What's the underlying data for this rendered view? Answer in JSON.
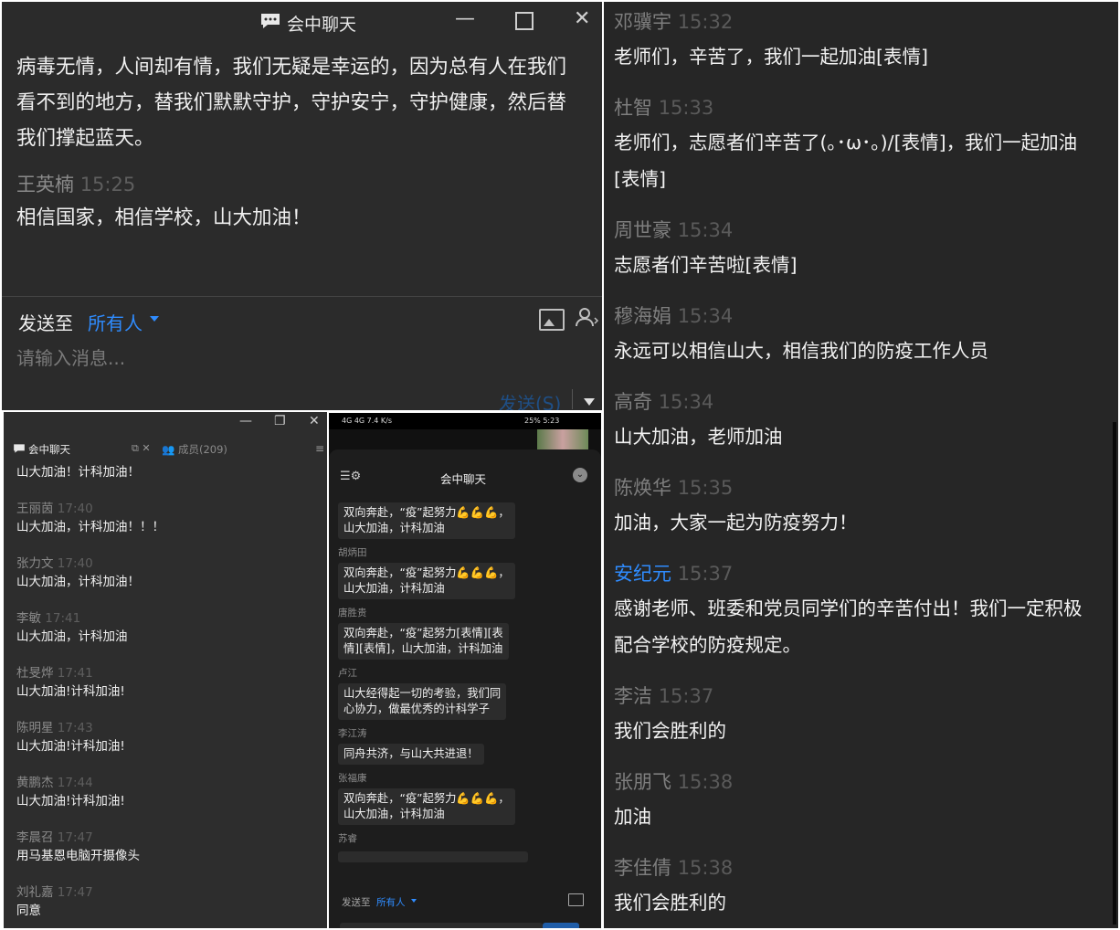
{
  "top_window": {
    "title": "会中聊天",
    "messages": [
      {
        "sender": "",
        "time": "",
        "lines": [
          "病毒无情，人间却有情，我们无疑是幸运的，因为总有人在我们",
          "看不到的地方，替我们默默守护，守护安宁，守护健康，然后替",
          "我们撑起蓝天。"
        ]
      },
      {
        "sender": "王英楠",
        "time": "15:25",
        "lines": [
          "相信国家，相信学校，山大加油！"
        ]
      }
    ],
    "send_to_label": "发送至",
    "send_to_target": "所有人",
    "input_placeholder": "请输入消息...",
    "send_button": "发送(S)"
  },
  "bottom_left_window": {
    "tab_chat": "会中聊天",
    "tab_members": "成员(209)",
    "first_message": "山大加油！计科加油！",
    "messages": [
      {
        "sender": "王丽茵",
        "time": "17:40",
        "text": "山大加油，计科加油！！！"
      },
      {
        "sender": "张力文",
        "time": "17:40",
        "text": "山大加油，计科加油！"
      },
      {
        "sender": "李敏",
        "time": "17:41",
        "text": "山大加油，计科加油"
      },
      {
        "sender": "杜旻烨",
        "time": "17:41",
        "text": "山大加油!计科加油!"
      },
      {
        "sender": "陈明星",
        "time": "17:43",
        "text": "山大加油!计科加油!"
      },
      {
        "sender": "黄鹏杰",
        "time": "17:44",
        "text": "山大加油!计科加油!"
      },
      {
        "sender": "李晨召",
        "time": "17:47",
        "text": "用马基恩电脑开摄像头"
      },
      {
        "sender": "刘礼嘉",
        "time": "17:47",
        "text": "同意"
      }
    ]
  },
  "phone": {
    "status_left": "4G 4G 7.4 K/s",
    "status_right": "25% 5:23",
    "title": "会中聊天",
    "first_bubble": [
      "双向奔赴，“疫”起努力💪💪💪，",
      "山大加油，计科加油"
    ],
    "messages": [
      {
        "sender": "胡炳田",
        "lines": [
          "双向奔赴，“疫”起努力💪💪💪，",
          "山大加油，计科加油"
        ]
      },
      {
        "sender": "唐胜贵",
        "lines": [
          "双向奔赴，“疫”起努力[表情][表",
          "情][表情]，山大加油，计科加油"
        ]
      },
      {
        "sender": "卢江",
        "lines": [
          "山大经得起一切的考验，我们同",
          "心协力，做最优秀的计科学子"
        ]
      },
      {
        "sender": "李江涛",
        "lines": [
          "同舟共济，与山大共进退！"
        ]
      },
      {
        "sender": "张福康",
        "lines": [
          "双向奔赴，“疫”起努力💪💪💪，",
          "山大加油，计科加油"
        ]
      },
      {
        "sender": "苏睿",
        "lines": []
      }
    ],
    "send_to_label": "发送至",
    "send_to_target": "所有人"
  },
  "right_panel": {
    "messages": [
      {
        "sender": "邓骥宇",
        "time": "15:32",
        "lines": [
          "老师们，辛苦了，我们一起加油[表情]"
        ]
      },
      {
        "sender": "杜智",
        "time": "15:33",
        "lines": [
          "老师们，志愿者们辛苦了(｡･ω･｡)/[表情]，我们一起加油",
          "[表情]"
        ]
      },
      {
        "sender": "周世豪",
        "time": "15:34",
        "lines": [
          "志愿者们辛苦啦[表情]"
        ]
      },
      {
        "sender": "穆海娟",
        "time": "15:34",
        "lines": [
          "永远可以相信山大，相信我们的防疫工作人员"
        ]
      },
      {
        "sender": "高奇",
        "time": "15:34",
        "lines": [
          "山大加油，老师加油"
        ]
      },
      {
        "sender": "陈焕华",
        "time": "15:35",
        "lines": [
          "加油，大家一起为防疫努力！"
        ]
      },
      {
        "sender": "安纪元",
        "time": "15:37",
        "lines": [
          "感谢老师、班委和党员同学们的辛苦付出！我们一定积极",
          "配合学校的防疫规定。"
        ],
        "highlight": true
      },
      {
        "sender": "李洁",
        "time": "15:37",
        "lines": [
          "我们会胜利的"
        ]
      },
      {
        "sender": "张朋飞",
        "time": "15:38",
        "lines": [
          "加油"
        ]
      },
      {
        "sender": "李佳倩",
        "time": "15:38",
        "lines": [
          "我们会胜利的"
        ]
      }
    ]
  },
  "colors": {
    "accent": "#2f8cff",
    "dark_bg": "#2b2b2b"
  }
}
